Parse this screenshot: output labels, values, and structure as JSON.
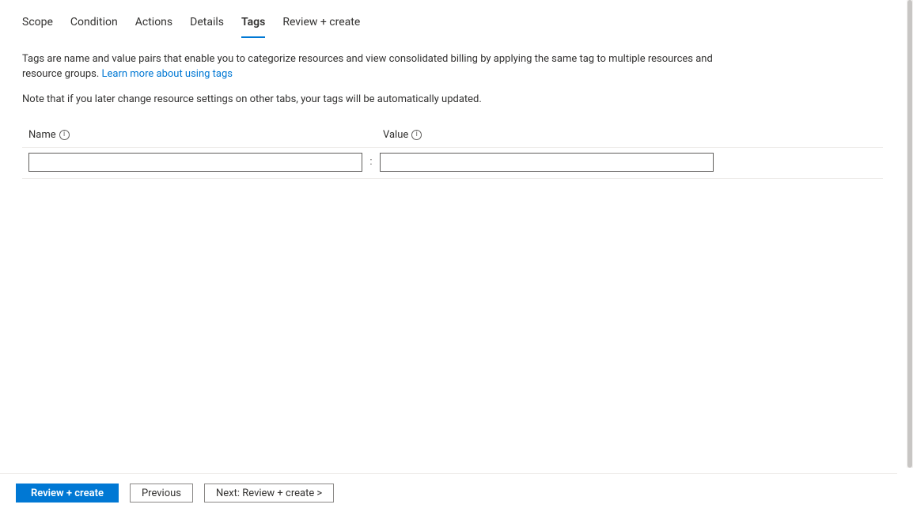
{
  "tabs": {
    "scope": "Scope",
    "condition": "Condition",
    "actions": "Actions",
    "details": "Details",
    "tags": "Tags",
    "review": "Review + create"
  },
  "description": {
    "text_a": "Tags are name and value pairs that enable you to categorize resources and view consolidated billing by applying the same tag to multiple resources and resource groups. ",
    "link": "Learn more about using tags"
  },
  "note": "Note that if you later change resource settings on other tabs, your tags will be automatically updated.",
  "table": {
    "name_header": "Name",
    "value_header": "Value",
    "separator": ":",
    "row": {
      "name_value": "",
      "value_value": ""
    }
  },
  "footer": {
    "review": "Review + create",
    "previous": "Previous",
    "next": "Next: Review + create >"
  },
  "info_glyph": "i"
}
